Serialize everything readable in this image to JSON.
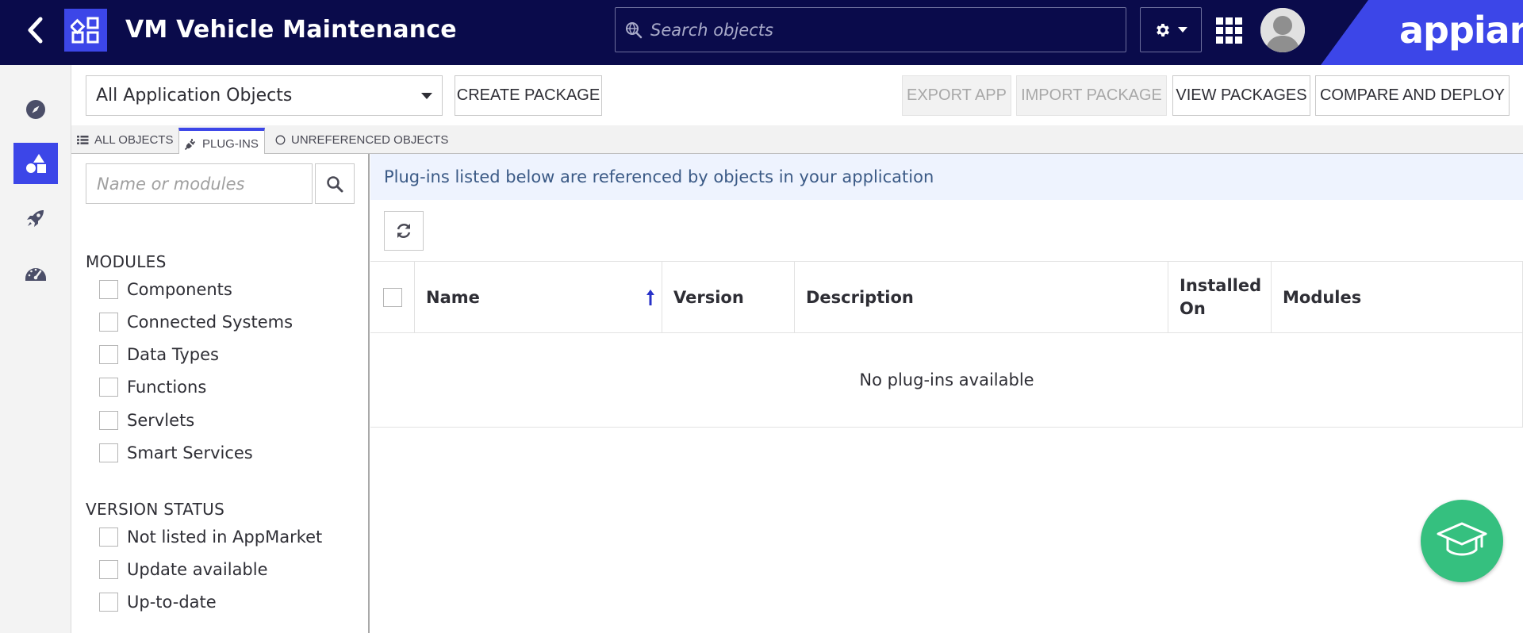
{
  "header": {
    "app_title": "VM Vehicle Maintenance",
    "search_placeholder": "Search objects",
    "brand": "appian",
    "colors": {
      "header_bg": "#0a0b4b",
      "accent": "#3c46e8"
    }
  },
  "rail": {
    "items": [
      {
        "icon": "compass-icon",
        "active": false
      },
      {
        "icon": "shapes-icon",
        "active": true
      },
      {
        "icon": "rocket-icon",
        "active": false
      },
      {
        "icon": "gauge-icon",
        "active": false
      }
    ]
  },
  "toolbar": {
    "object_filter": "All Application Objects",
    "create_package": "CREATE PACKAGE",
    "export_app": "EXPORT APP",
    "import_package": "IMPORT PACKAGE",
    "view_packages": "VIEW PACKAGES",
    "compare_and_deploy": "COMPARE AND DEPLOY"
  },
  "tabs": [
    {
      "label": "ALL OBJECTS",
      "icon": "list-icon",
      "active": false
    },
    {
      "label": "PLUG-INS",
      "icon": "plug-icon",
      "active": true
    },
    {
      "label": "UNREFERENCED OBJECTS",
      "icon": "circle-icon",
      "active": false
    }
  ],
  "filters": {
    "search_placeholder": "Name or modules",
    "modules_title": "MODULES",
    "modules": [
      "Components",
      "Connected Systems",
      "Data Types",
      "Functions",
      "Servlets",
      "Smart Services"
    ],
    "version_status_title": "VERSION STATUS",
    "version_status": [
      "Not listed in AppMarket",
      "Update available",
      "Up-to-date"
    ]
  },
  "main": {
    "info": "Plug-ins listed below are referenced by objects in your application",
    "columns": [
      "Name",
      "Version",
      "Description",
      "Installed On",
      "Modules"
    ],
    "sorted_column": "Name",
    "sort_direction": "ascending",
    "empty_message": "No plug-ins available"
  }
}
